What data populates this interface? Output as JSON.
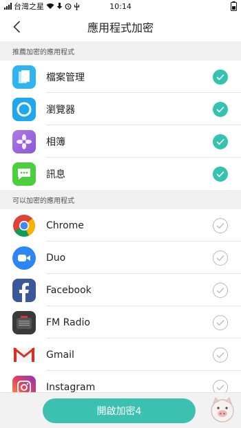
{
  "status": {
    "carrier": "台灣之星",
    "time": "10:14"
  },
  "header": {
    "title": "應用程式加密"
  },
  "sections": {
    "recommended": "推薦加密的應用程式",
    "available": "可以加密的應用程式"
  },
  "recommended": [
    {
      "name": "檔案管理",
      "checked": true,
      "icon": "file-manager-icon"
    },
    {
      "name": "瀏覽器",
      "checked": true,
      "icon": "browser-icon"
    },
    {
      "name": "相簿",
      "checked": true,
      "icon": "photos-icon"
    },
    {
      "name": "訊息",
      "checked": true,
      "icon": "messages-icon"
    }
  ],
  "available": [
    {
      "name": "Chrome",
      "checked": false,
      "icon": "chrome-icon"
    },
    {
      "name": "Duo",
      "checked": false,
      "icon": "duo-icon"
    },
    {
      "name": "Facebook",
      "checked": false,
      "icon": "facebook-icon"
    },
    {
      "name": "FM Radio",
      "checked": false,
      "icon": "fm-radio-icon"
    },
    {
      "name": "Gmail",
      "checked": false,
      "icon": "gmail-icon"
    },
    {
      "name": "Instagram",
      "checked": false,
      "icon": "instagram-icon"
    }
  ],
  "footer": {
    "button_label": "開啟加密4"
  },
  "colors": {
    "accent": "#35c3b0",
    "button": "#3cc1b1"
  }
}
